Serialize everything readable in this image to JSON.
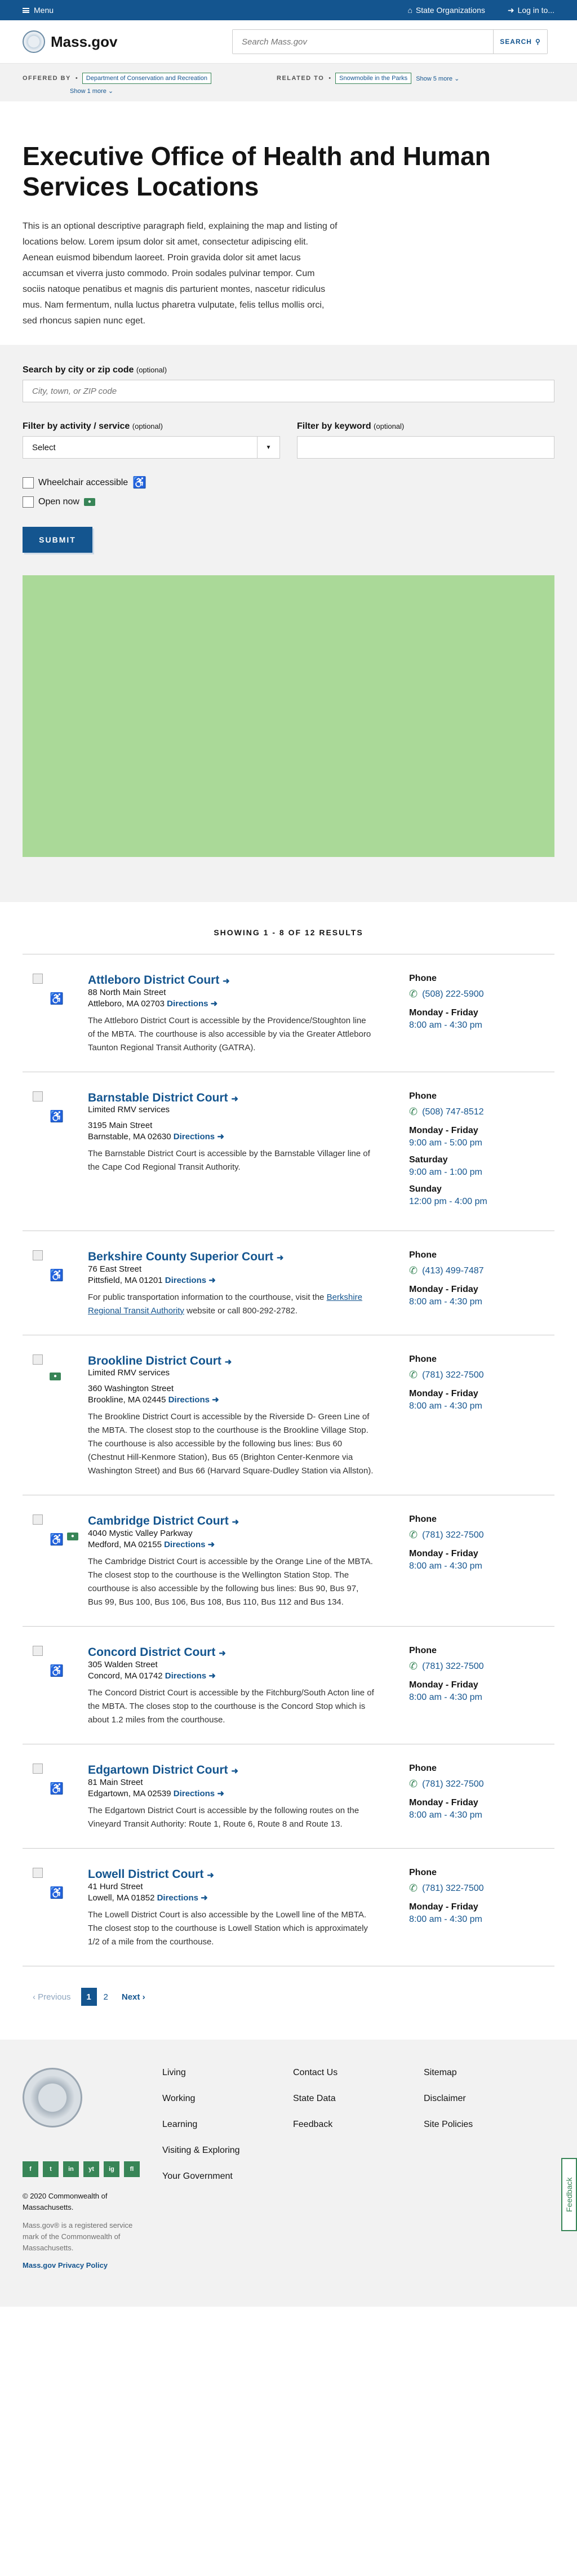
{
  "utility": {
    "menu_label": "Menu",
    "state_orgs_label": "State Organizations",
    "login_label": "Log in to..."
  },
  "header": {
    "logo_text": "Mass.gov",
    "search_placeholder": "Search Mass.gov",
    "search_button": "SEARCH"
  },
  "relationships": {
    "offered_by_label": "OFFERED BY",
    "offered_by_tag": "Department of Conservation and Recreation",
    "offered_show_more": "Show 1 more",
    "related_label": "RELATED TO",
    "related_tag": "Snowmobile in the Parks",
    "related_show_more": "Show 5 more"
  },
  "page": {
    "title": "Executive Office of Health and Human Services Locations",
    "intro": "This is an optional descriptive paragraph field, explaining the map and listing of locations below. Lorem ipsum dolor sit amet, consectetur adipiscing elit. Aenean euismod bibendum laoreet. Proin gravida dolor sit amet lacus accumsan et viverra justo commodo. Proin sodales pulvinar tempor. Cum sociis natoque penatibus et magnis dis parturient montes, nascetur ridiculus mus. Nam fermentum, nulla luctus pharetra vulputate, felis tellus mollis orci, sed rhoncus sapien nunc eget."
  },
  "filters": {
    "city_label": "Search by city or zip code",
    "optional": "(optional)",
    "city_placeholder": "City, town, or ZIP code",
    "activity_label": "Filter by activity / service",
    "activity_value": "Select",
    "keyword_label": "Filter by keyword",
    "wheelchair_label": "Wheelchair accessible",
    "open_now_label": "Open now",
    "submit_label": "SUBMIT"
  },
  "results": {
    "showing_text": "SHOWING 1 - 8 OF 12 RESULTS",
    "phone_heading": "Phone",
    "directions_label": "Directions",
    "items": [
      {
        "name": "Attleboro District Court",
        "note": "",
        "address1": "88 North Main Street",
        "address2": "Attleboro, MA 02703",
        "description": "The Attleboro District Court is accessible by the Providence/Stoughton line of the MBTA. The courthouse is also accessible by via the Greater Attleboro Taunton Regional Transit Authority (GATRA).",
        "phone": "(508) 222-5900",
        "hours": [
          {
            "day": "Monday - Friday",
            "time": "8:00 am - 4:30 pm"
          }
        ]
      },
      {
        "name": "Barnstable District Court",
        "note": "Limited RMV services",
        "address1": "3195 Main Street",
        "address2": "Barnstable, MA 02630",
        "description": "The Barnstable District Court is accessible by the Barnstable Villager line of the Cape Cod Regional Transit Authority.",
        "phone": "(508) 747-8512",
        "hours": [
          {
            "day": "Monday - Friday",
            "time": "9:00 am - 5:00 pm"
          },
          {
            "day": "Saturday",
            "time": "9:00 am - 1:00 pm"
          },
          {
            "day": "Sunday",
            "time": "12:00 pm - 4:00 pm"
          }
        ]
      },
      {
        "name": "Berkshire County Superior Court",
        "note": "",
        "address1": "76 East Street",
        "address2": "Pittsfield, MA 01201",
        "description_pre": "For public transportation information to the courthouse, visit the ",
        "description_link": "Berkshire Regional Transit Authority",
        "description_post": " website or call 800-292-2782.",
        "phone": "(413) 499-7487",
        "hours": [
          {
            "day": "Monday - Friday",
            "time": "8:00 am - 4:30 pm"
          }
        ]
      },
      {
        "name": "Brookline District Court",
        "note": "Limited RMV services",
        "address1": "360 Washington Street",
        "address2": "Brookline, MA 02445",
        "description": "The Brookline District Court is accessible by the Riverside D- Green Line of the MBTA. The closest stop to the courthouse is the Brookline Village Stop. The courthouse is also accessible by the following bus lines: Bus 60 (Chestnut Hill-Kenmore Station), Bus 65 (Brighton Center-Kenmore via Washington Street) and Bus 66 (Harvard Square-Dudley Station via Allston).",
        "phone": "(781) 322-7500",
        "hours": [
          {
            "day": "Monday - Friday",
            "time": "8:00 am - 4:30 pm"
          }
        ]
      },
      {
        "name": "Cambridge District Court",
        "note": "",
        "address1": "4040 Mystic Valley Parkway",
        "address2": "Medford, MA 02155",
        "description": "The Cambridge District Court is accessible by the Orange Line of the MBTA. The closest stop to the courthouse is the Wellington Station Stop. The courthouse is also accessible by the following bus lines: Bus 90, Bus 97, Bus 99, Bus 100, Bus 106, Bus 108, Bus 110, Bus 112 and Bus 134.",
        "phone": "(781) 322-7500",
        "hours": [
          {
            "day": "Monday - Friday",
            "time": "8:00 am - 4:30 pm"
          }
        ]
      },
      {
        "name": "Concord District Court",
        "note": "",
        "address1": "305 Walden Street",
        "address2": "Concord, MA 01742",
        "description": "The Concord District Court is accessible by the Fitchburg/South Acton line of the MBTA. The closes stop to the courthouse is the Concord Stop which is about 1.2 miles from the courthouse.",
        "phone": "(781) 322-7500",
        "hours": [
          {
            "day": "Monday - Friday",
            "time": "8:00 am - 4:30 pm"
          }
        ]
      },
      {
        "name": "Edgartown District Court",
        "note": "",
        "address1": "81 Main Street",
        "address2": "Edgartown, MA 02539",
        "description": "The Edgartown District Court is accessible by the following routes on the Vineyard Transit Authority: Route 1, Route 6, Route 8 and Route 13.",
        "phone": "(781) 322-7500",
        "hours": [
          {
            "day": "Monday - Friday",
            "time": "8:00 am - 4:30 pm"
          }
        ]
      },
      {
        "name": "Lowell District Court",
        "note": "",
        "address1": "41 Hurd Street",
        "address2": "Lowell, MA 01852",
        "description": "The Lowell District Court is also accessible by the Lowell line of the MBTA. The closest stop to the courthouse is Lowell Station which is approximately 1/2 of a mile from the courthouse.",
        "phone": "(781) 322-7500",
        "hours": [
          {
            "day": "Monday - Friday",
            "time": "8:00 am - 4:30 pm"
          }
        ]
      }
    ]
  },
  "pagination": {
    "prev": "Previous",
    "current": "1",
    "page2": "2",
    "next": "Next"
  },
  "footer": {
    "social": [
      "f",
      "t",
      "in",
      "yt",
      "ig",
      "fl"
    ],
    "copyright": "© 2020 Commonwealth of Massachusetts.",
    "trademark": "Mass.gov® is a registered service mark of the Commonwealth of Massachusetts.",
    "privacy": "Mass.gov Privacy Policy",
    "col1": [
      "Living",
      "Working",
      "Learning",
      "Visiting & Exploring",
      "Your Government"
    ],
    "col2": [
      "Contact Us",
      "State Data",
      "Feedback"
    ],
    "col3": [
      "Sitemap",
      "Disclaimer",
      "Site Policies"
    ],
    "feedback_tab": "Feedback"
  }
}
